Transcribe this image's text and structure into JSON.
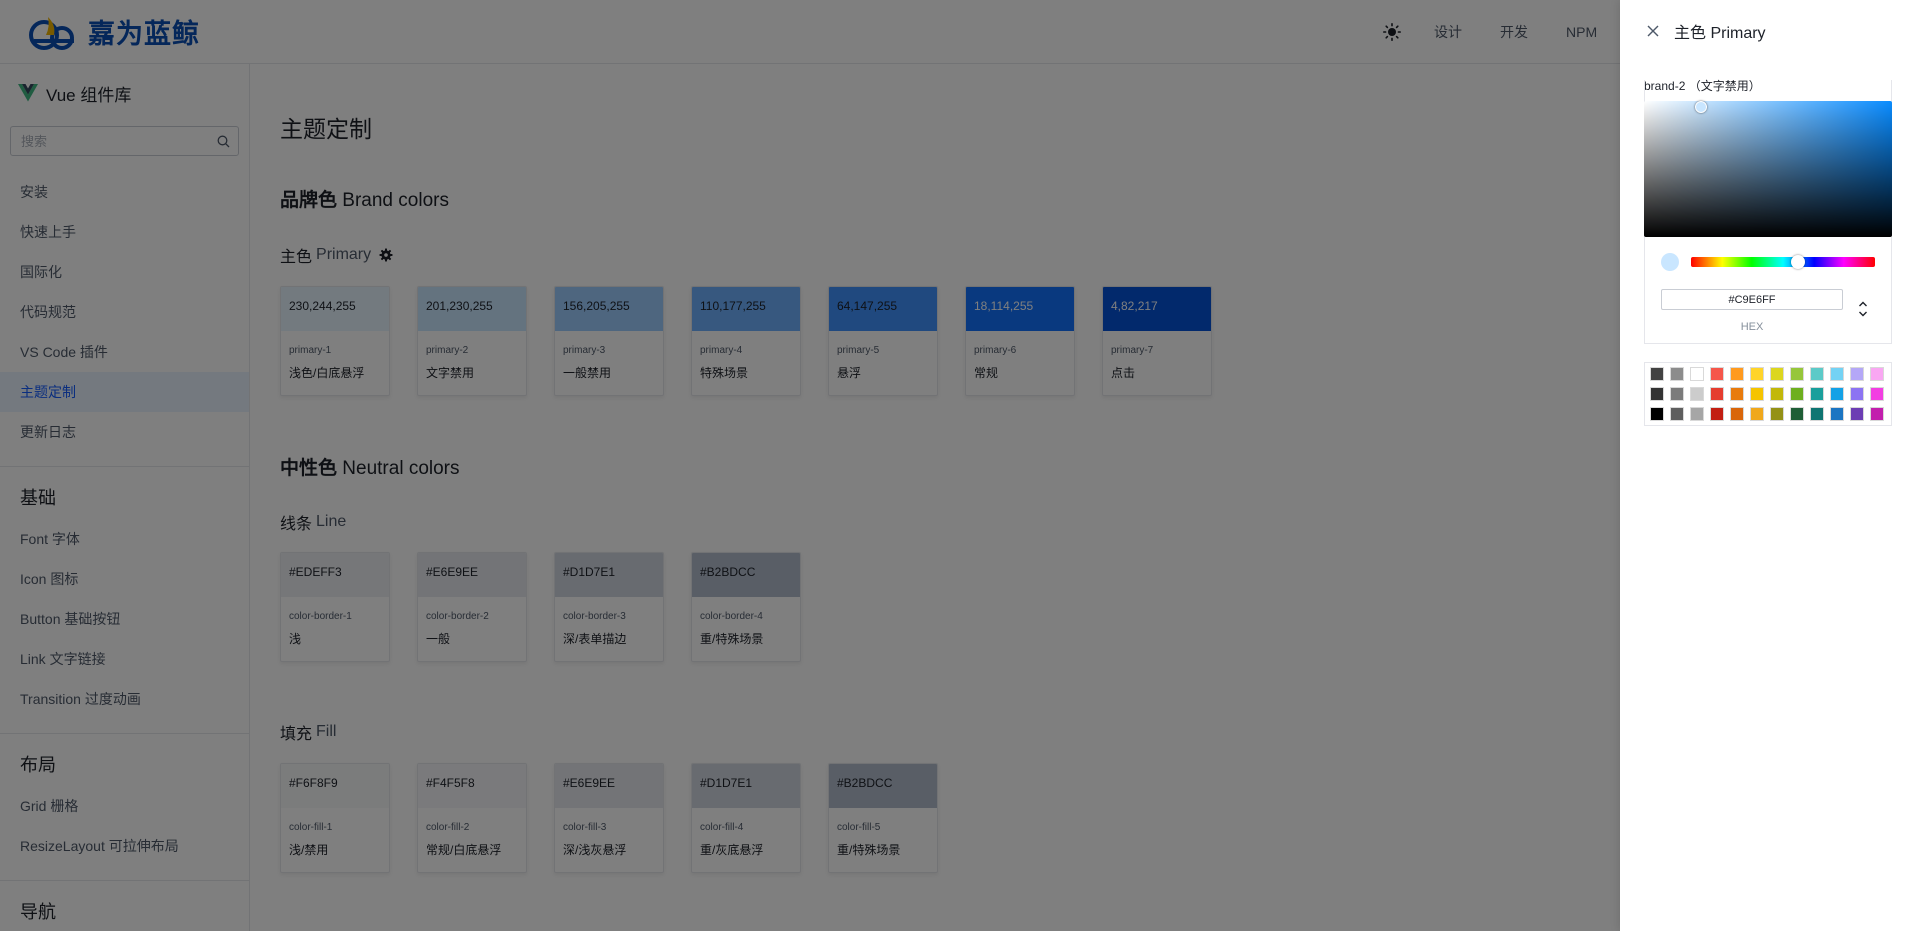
{
  "header": {
    "logo_text": "嘉为蓝鲸",
    "nav": [
      "设计",
      "开发",
      "NPM"
    ]
  },
  "sidebar": {
    "brand": "Vue 组件库",
    "search_placeholder": "搜索",
    "items": [
      "安装",
      "快速上手",
      "国际化",
      "代码规范",
      "VS Code 插件",
      "主题定制",
      "更新日志"
    ],
    "active_item": "主题定制",
    "groups": [
      {
        "title": "基础",
        "items": [
          "Font 字体",
          "Icon 图标",
          "Button 基础按钮",
          "Link 文字链接",
          "Transition 过度动画"
        ]
      },
      {
        "title": "布局",
        "items": [
          "Grid 栅格",
          "ResizeLayout 可拉伸布局"
        ]
      },
      {
        "title": "导航",
        "items": []
      }
    ]
  },
  "main": {
    "title": "主题定制",
    "brand_section": {
      "zh": "品牌色",
      "en": "Brand colors"
    },
    "primary_title": {
      "zh": "主色",
      "en": "Primary"
    },
    "primary_swatches": [
      {
        "value": "230,244,255",
        "token": "primary-1",
        "desc": "浅色/白底悬浮",
        "color": "#e6f4ff",
        "light_text": false
      },
      {
        "value": "201,230,255",
        "token": "primary-2",
        "desc": "文字禁用",
        "color": "#c9e6ff",
        "light_text": false
      },
      {
        "value": "156,205,255",
        "token": "primary-3",
        "desc": "一般禁用",
        "color": "#9ccdff",
        "light_text": false
      },
      {
        "value": "110,177,255",
        "token": "primary-4",
        "desc": "特殊场景",
        "color": "#6eb1ff",
        "light_text": false
      },
      {
        "value": "64,147,255",
        "token": "primary-5",
        "desc": "悬浮",
        "color": "#4093ff",
        "light_text": false
      },
      {
        "value": "18,114,255",
        "token": "primary-6",
        "desc": "常规",
        "color": "#1272ff",
        "light_text": true
      },
      {
        "value": "4,82,217",
        "token": "primary-7",
        "desc": "点击",
        "color": "#0452d9",
        "light_text": true
      }
    ],
    "neutral_section": {
      "zh": "中性色",
      "en": "Neutral colors"
    },
    "line_title": {
      "zh": "线条",
      "en": "Line"
    },
    "line_swatches": [
      {
        "value": "#EDEFF3",
        "token": "color-border-1",
        "desc": "浅",
        "color": "#edeff3"
      },
      {
        "value": "#E6E9EE",
        "token": "color-border-2",
        "desc": "一般",
        "color": "#e6e9ee"
      },
      {
        "value": "#D1D7E1",
        "token": "color-border-3",
        "desc": "深/表单描边",
        "color": "#d1d7e1"
      },
      {
        "value": "#B2BDCC",
        "token": "color-border-4",
        "desc": "重/特殊场景",
        "color": "#b2bdcc"
      }
    ],
    "fill_title": {
      "zh": "填充",
      "en": "Fill"
    },
    "fill_swatches": [
      {
        "value": "#F6F8F9",
        "token": "color-fill-1",
        "desc": "浅/禁用",
        "color": "#f6f8f9"
      },
      {
        "value": "#F4F5F8",
        "token": "color-fill-2",
        "desc": "常规/白底悬浮",
        "color": "#f4f5f8"
      },
      {
        "value": "#E6E9EE",
        "token": "color-fill-3",
        "desc": "深/浅灰悬浮",
        "color": "#e6e9ee"
      },
      {
        "value": "#D1D7E1",
        "token": "color-fill-4",
        "desc": "重/灰底悬浮",
        "color": "#d1d7e1"
      },
      {
        "value": "#B2BDCC",
        "token": "color-fill-5",
        "desc": "重/特殊场景",
        "color": "#b2bdcc"
      }
    ]
  },
  "drawer": {
    "title": "主色 Primary",
    "color_label": "brand-2 （文字禁用）",
    "hex_value": "#C9E6FF",
    "mode_label": "HEX",
    "current_color": "#c9e6ff",
    "hue_color": "#0a8cff",
    "presets": [
      "#424242",
      "#8c8c8c",
      "#ffffff",
      "#f5564a",
      "#ff9a1f",
      "#ffd42a",
      "#dcd61f",
      "#96c63a",
      "#5ccac8",
      "#73d2f4",
      "#b4a7f7",
      "#f9a7f2",
      "#333333",
      "#7b7b7b",
      "#cccccc",
      "#e53d2f",
      "#e87b0d",
      "#f5c400",
      "#c2b80a",
      "#6eaf1f",
      "#1a9f9c",
      "#14a1e6",
      "#8c73f2",
      "#f23ee2",
      "#000000",
      "#5e5e5e",
      "#a6a6a6",
      "#c21f12",
      "#d9660a",
      "#f0a81c",
      "#949116",
      "#1f5e36",
      "#0f7572",
      "#1b75c2",
      "#6c3db3",
      "#c21fad"
    ]
  }
}
